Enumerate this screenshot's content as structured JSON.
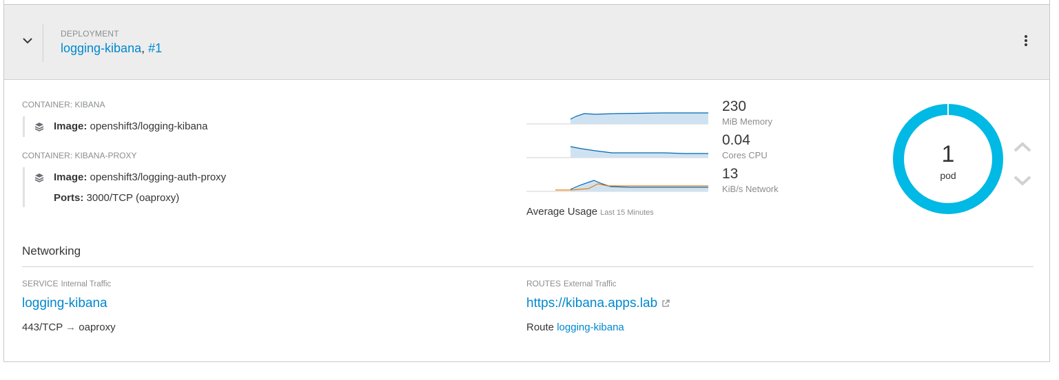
{
  "deployment": {
    "label": "DEPLOYMENT",
    "name": "logging-kibana",
    "separator": ", ",
    "revision": "#1"
  },
  "containers": [
    {
      "label": "CONTAINER: KIBANA",
      "image_label": "Image:",
      "image": "openshift3/logging-kibana"
    },
    {
      "label": "CONTAINER: KIBANA-PROXY",
      "image_label": "Image:",
      "image": "openshift3/logging-auth-proxy",
      "ports_label": "Ports:",
      "ports": "3000/TCP (oaproxy)"
    }
  ],
  "metrics": {
    "memory": {
      "value": "230",
      "unit": "MiB Memory"
    },
    "cpu": {
      "value": "0.04",
      "unit": "Cores CPU"
    },
    "network": {
      "value": "13",
      "unit": "KiB/s Network"
    },
    "avg_label": "Average Usage",
    "avg_period": "Last 15 Minutes"
  },
  "pods": {
    "count": "1",
    "label": "pod",
    "ring_color": "#00b9e4"
  },
  "networking": {
    "title": "Networking",
    "service": {
      "label": "SERVICE",
      "sub": "Internal Traffic",
      "name": "logging-kibana",
      "port_from": "443/TCP",
      "arrow": "→",
      "port_to": "oaproxy"
    },
    "routes": {
      "label": "ROUTES",
      "sub": "External Traffic",
      "url": "https://kibana.apps.lab",
      "route_label": "Route",
      "route_name": "logging-kibana"
    }
  },
  "colors": {
    "link": "#0088ce",
    "header_bg": "#ededed",
    "spark_fill": "#cfe2f1",
    "spark_line": "#0066b1",
    "spark_line2": "#ec7a08"
  },
  "icons": [
    "chevron-down-icon",
    "kebab-menu-icon",
    "layers-icon",
    "external-link-icon",
    "chevron-up-icon"
  ]
}
